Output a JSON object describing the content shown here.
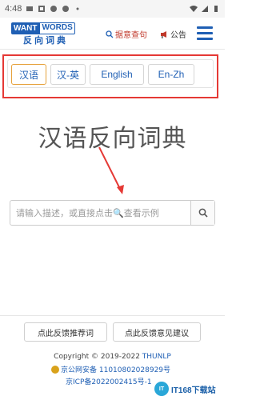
{
  "status_bar": {
    "time": "4:48"
  },
  "header": {
    "logo": {
      "want": "WANT",
      "words": "WORDS",
      "subtitle": "反向词典"
    },
    "random_search": "据意查句",
    "notice": "公告"
  },
  "tabs": [
    {
      "label": "汉语",
      "active": true
    },
    {
      "label": "汉-英",
      "active": false
    },
    {
      "label": "English",
      "active": false
    },
    {
      "label": "En-Zh",
      "active": false
    }
  ],
  "main": {
    "title": "汉语反向词典",
    "search_placeholder": "请输入描述，或直接点击🔍查看示例"
  },
  "footer": {
    "feedback_words": "点此反馈推荐词",
    "feedback_suggestions": "点此反馈意见建议",
    "copyright_prefix": "Copyright © 2019-2022 ",
    "copyright_org": "THUNLP",
    "gongan": "京公网安备 11010802028929号",
    "icp": "京ICP备2022002415号-1"
  },
  "watermark": {
    "logo": "IT",
    "text": "IT168下载站"
  },
  "colors": {
    "brand_blue": "#1f5fb4",
    "highlight_red": "#e53935",
    "active_tab_border": "#e6a23c"
  }
}
